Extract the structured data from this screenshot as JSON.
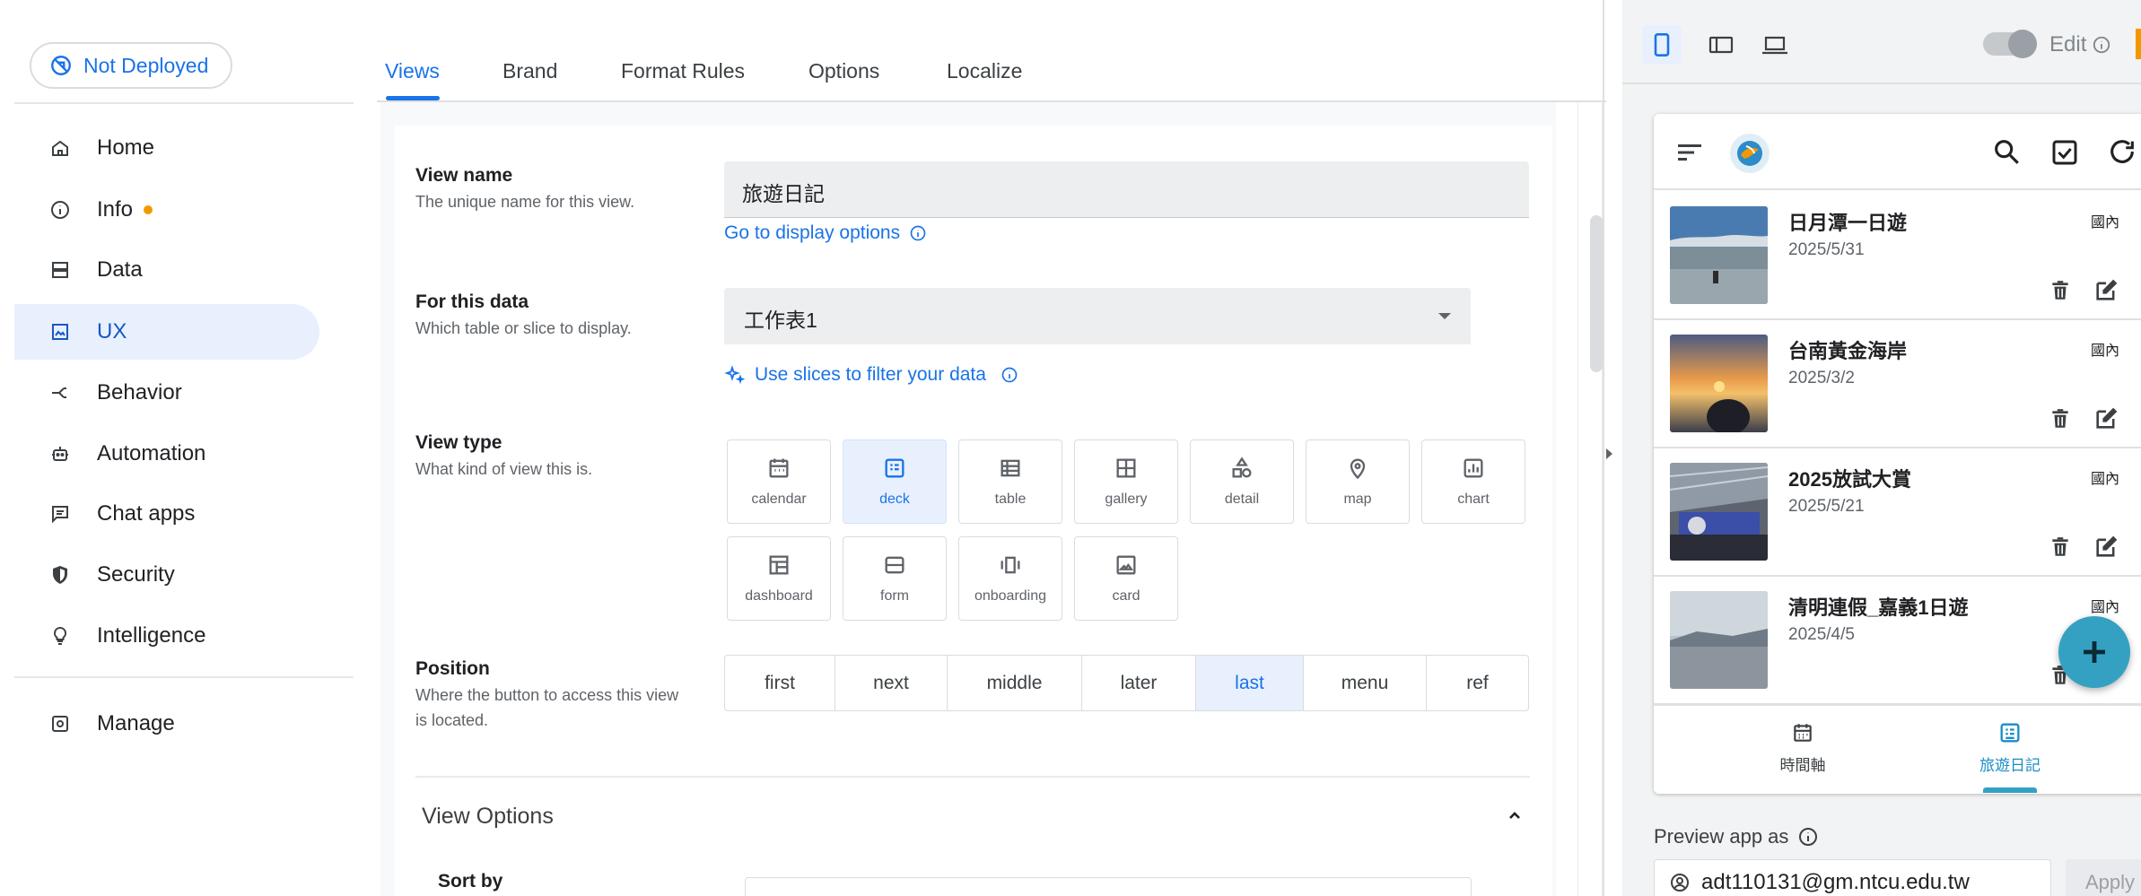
{
  "sidebar": {
    "deploy_status": "Not Deployed",
    "items": [
      {
        "label": "Home"
      },
      {
        "label": "Info"
      },
      {
        "label": "Data"
      },
      {
        "label": "UX"
      },
      {
        "label": "Behavior"
      },
      {
        "label": "Automation"
      },
      {
        "label": "Chat apps"
      },
      {
        "label": "Security"
      },
      {
        "label": "Intelligence"
      },
      {
        "label": "Manage"
      }
    ],
    "active_item": "UX",
    "info_dot_color": "#f29900"
  },
  "tabs": [
    {
      "label": "Views"
    },
    {
      "label": "Brand"
    },
    {
      "label": "Format Rules"
    },
    {
      "label": "Options"
    },
    {
      "label": "Localize"
    }
  ],
  "active_tab": "Views",
  "form": {
    "view_name": {
      "title": "View name",
      "subtitle": "The unique name for this view.",
      "value": "旅遊日記",
      "link": "Go to display options"
    },
    "for_this_data": {
      "title": "For this data",
      "subtitle": "Which table or slice to display.",
      "value": "工作表1",
      "link": "Use slices to filter your data"
    },
    "view_type": {
      "title": "View type",
      "subtitle": "What kind of view this is.",
      "options": [
        {
          "label": "calendar",
          "icon": "calendar-icon"
        },
        {
          "label": "deck",
          "icon": "deck-icon"
        },
        {
          "label": "table",
          "icon": "table-icon"
        },
        {
          "label": "gallery",
          "icon": "gallery-icon"
        },
        {
          "label": "detail",
          "icon": "detail-icon"
        },
        {
          "label": "map",
          "icon": "map-pin-icon"
        },
        {
          "label": "chart",
          "icon": "chart-icon"
        },
        {
          "label": "dashboard",
          "icon": "dashboard-icon"
        },
        {
          "label": "form",
          "icon": "form-icon"
        },
        {
          "label": "onboarding",
          "icon": "onboarding-icon"
        },
        {
          "label": "card",
          "icon": "card-icon"
        }
      ],
      "selected": "deck"
    },
    "position": {
      "title": "Position",
      "subtitle": "Where the button to access this view is located.",
      "options": [
        "first",
        "next",
        "middle",
        "later",
        "last",
        "menu",
        "ref"
      ],
      "selected": "last"
    },
    "view_options": {
      "title": "View Options",
      "sort_by": "Sort by"
    }
  },
  "preview": {
    "edit_label": "Edit",
    "cards": [
      {
        "title": "日月潭一日遊",
        "date": "2025/5/31",
        "tag": "國內"
      },
      {
        "title": "台南黃金海岸",
        "date": "2025/3/2",
        "tag": "國內"
      },
      {
        "title": "2025放試大賞",
        "date": "2025/5/21",
        "tag": "國內"
      },
      {
        "title": "清明連假_嘉義1日遊",
        "date": "2025/4/5",
        "tag": "國內"
      }
    ],
    "bottom_nav": [
      {
        "label": "時間軸"
      },
      {
        "label": "旅遊日記"
      }
    ],
    "preview_as_label": "Preview app as",
    "email": "adt110131@gm.ntcu.edu.tw",
    "apply_label": "Apply",
    "accent_color": "#35a1c2"
  }
}
